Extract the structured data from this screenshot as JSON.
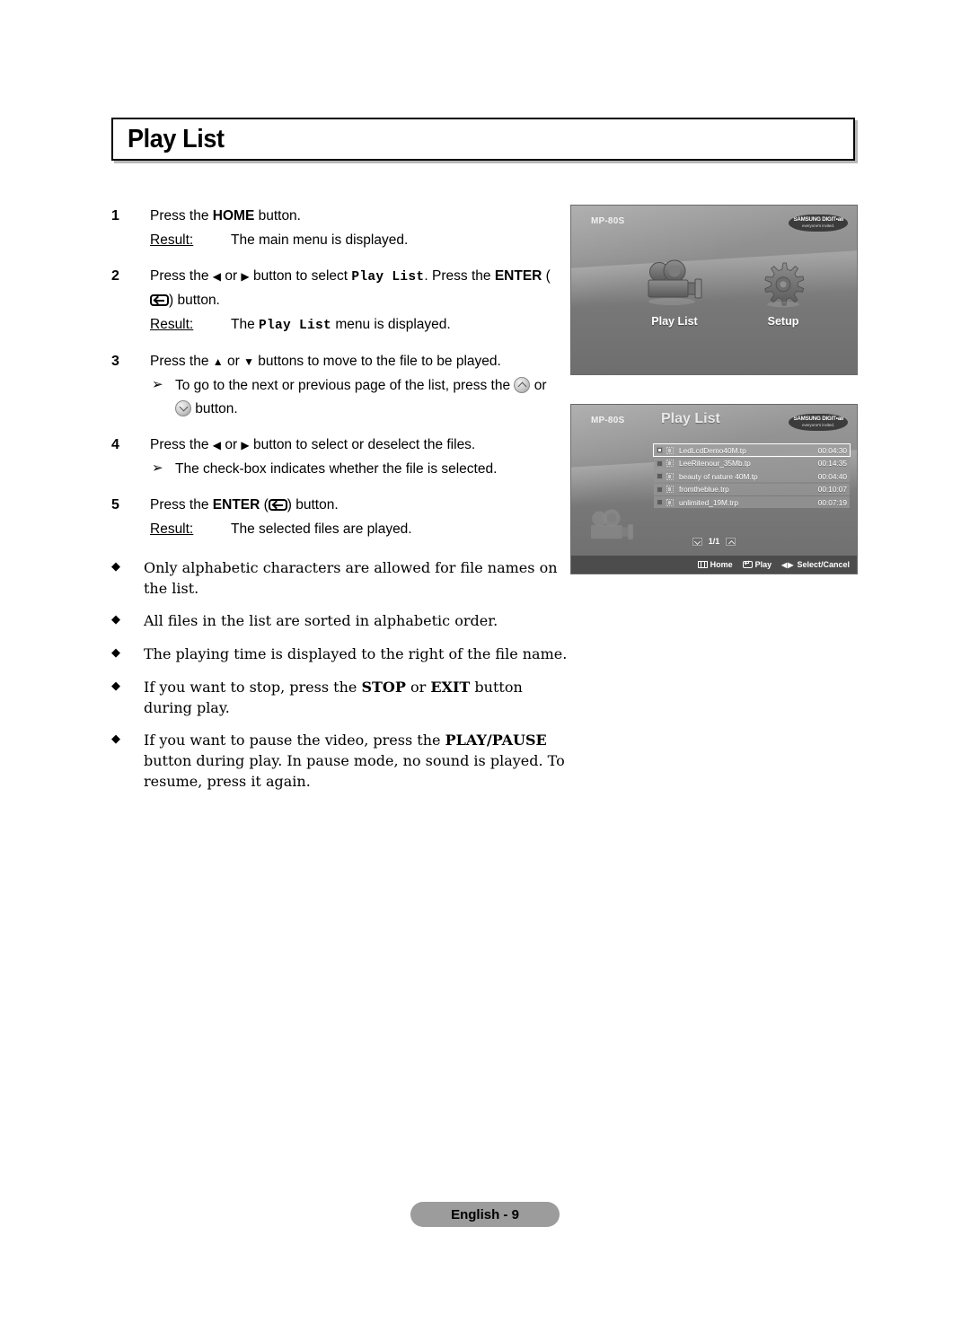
{
  "page": {
    "title": "Play List",
    "footer_label": "English - 9"
  },
  "steps": [
    {
      "num": "1",
      "line_parts": [
        {
          "t": "Press the ",
          "style": "normal"
        },
        {
          "t": "HOME",
          "style": "bold"
        },
        {
          "t": " button.",
          "style": "normal"
        }
      ],
      "result_label": "Result:",
      "result_parts": [
        {
          "t": "The main menu is displayed.",
          "style": "normal"
        }
      ]
    },
    {
      "num": "2",
      "line_parts": [
        {
          "t": "Press the ",
          "style": "normal"
        },
        {
          "t": "◀",
          "style": "glyph"
        },
        {
          "t": " or ",
          "style": "normal"
        },
        {
          "t": "▶",
          "style": "glyph"
        },
        {
          "t": " button to select ",
          "style": "normal"
        },
        {
          "t": "Play List",
          "style": "mono"
        },
        {
          "t": ". Press the ",
          "style": "normal"
        },
        {
          "t": "ENTER",
          "style": "bold"
        },
        {
          "t": " (",
          "style": "normal"
        },
        {
          "t": "enter-icon",
          "style": "icon"
        },
        {
          "t": ") button.",
          "style": "normal"
        }
      ],
      "result_label": "Result:",
      "result_parts": [
        {
          "t": "The ",
          "style": "normal"
        },
        {
          "t": "Play List",
          "style": "mono"
        },
        {
          "t": " menu is displayed.",
          "style": "normal"
        }
      ]
    },
    {
      "num": "3",
      "line_parts": [
        {
          "t": "Press the ",
          "style": "normal"
        },
        {
          "t": "▲",
          "style": "glyph"
        },
        {
          "t": " or ",
          "style": "normal"
        },
        {
          "t": "▼",
          "style": "glyph"
        },
        {
          "t": " buttons to move to the file to be played.",
          "style": "normal"
        }
      ],
      "sub_arrow": "➢",
      "sub_parts": [
        {
          "t": "To go to the next or previous page of the list, press the ",
          "style": "normal"
        },
        {
          "t": "circle-up-icon",
          "style": "icon"
        },
        {
          "t": " or ",
          "style": "normal"
        },
        {
          "t": "circle-down-icon",
          "style": "icon"
        },
        {
          "t": " button.",
          "style": "normal"
        }
      ]
    },
    {
      "num": "4",
      "line_parts": [
        {
          "t": "Press the ",
          "style": "normal"
        },
        {
          "t": "◀",
          "style": "glyph"
        },
        {
          "t": " or ",
          "style": "normal"
        },
        {
          "t": "▶",
          "style": "glyph"
        },
        {
          "t": " button to select or deselect the files.",
          "style": "normal"
        }
      ],
      "sub_arrow": "➢",
      "sub_parts": [
        {
          "t": "The check-box indicates whether the file is selected.",
          "style": "normal"
        }
      ]
    },
    {
      "num": "5",
      "line_parts": [
        {
          "t": "Press the ",
          "style": "normal"
        },
        {
          "t": "ENTER",
          "style": "bold"
        },
        {
          "t": " (",
          "style": "normal"
        },
        {
          "t": "enter-icon",
          "style": "icon"
        },
        {
          "t": ") button.",
          "style": "normal"
        }
      ],
      "result_label": "Result:",
      "result_parts": [
        {
          "t": "The selected files are played.",
          "style": "normal"
        }
      ]
    }
  ],
  "notes": {
    "bullet_glyph": "◆",
    "items": [
      [
        {
          "t": "Only alphabetic characters are allowed for file names on the list.",
          "style": "normal"
        }
      ],
      [
        {
          "t": "All files in the list are sorted in alphabetic order.",
          "style": "normal"
        }
      ],
      [
        {
          "t": "The playing time is displayed to the right of the file name.",
          "style": "normal"
        }
      ],
      [
        {
          "t": "If you want to stop, press the ",
          "style": "normal"
        },
        {
          "t": "STOP",
          "style": "bold"
        },
        {
          "t": " or ",
          "style": "normal"
        },
        {
          "t": "EXIT",
          "style": "bold"
        },
        {
          "t": " button during play.",
          "style": "normal"
        }
      ],
      [
        {
          "t": "If you want to pause the video, press the ",
          "style": "normal"
        },
        {
          "t": "PLAY/PAUSE",
          "style": "bold"
        },
        {
          "t": " button during play. In pause mode, no sound is played. To resume, press it again.",
          "style": "normal"
        }
      ]
    ]
  },
  "screenshots": {
    "main_menu": {
      "model": "MP-80S",
      "logo_line1": "SAMSUNG DIGIT•all",
      "logo_line2": "everyone's invited.",
      "items": [
        {
          "label": "Play List",
          "icon": "camcorder-icon"
        },
        {
          "label": "Setup",
          "icon": "gear-icon"
        }
      ]
    },
    "play_list": {
      "model": "MP-80S",
      "title": "Play List",
      "logo_line1": "SAMSUNG DIGIT•all",
      "logo_line2": "everyone's invited.",
      "files": [
        {
          "name": "LedLcdDemo40M.tp",
          "time": "00:04:30",
          "selected": true
        },
        {
          "name": "LeeRitenour_35Mb.tp",
          "time": "00:14:35",
          "selected": false
        },
        {
          "name": "beauty of nature 40M.tp",
          "time": "00:04:40",
          "selected": false
        },
        {
          "name": "fromtheblue.trp",
          "time": "00:10:07",
          "selected": false
        },
        {
          "name": "unlimited_19M.trp",
          "time": "00:07:19",
          "selected": false
        }
      ],
      "pager": "1/1",
      "footer_items": [
        {
          "icon": "home-icon",
          "label": "Home"
        },
        {
          "icon": "enter-icon",
          "label": "Play"
        },
        {
          "icon": "left-right-icon",
          "label": "Select/Cancel"
        }
      ]
    }
  },
  "colors": {
    "screen_dark": "#6e6e6e",
    "screen_light": "#9a9a9a",
    "footer_bar": "#4c4c4c",
    "pill": "#9c9c9c"
  }
}
